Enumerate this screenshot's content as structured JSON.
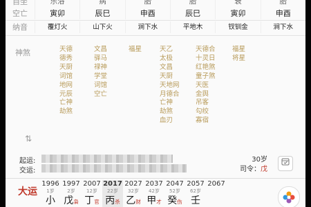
{
  "pillars_table": {
    "labels": [
      "自坐",
      "空亡",
      "纳音"
    ],
    "columns": [
      {
        "top": "乐浴",
        "kongwang": "寅卯",
        "nayin": "覆灯火"
      },
      {
        "top": "病",
        "kongwang": "辰巳",
        "nayin": "山下火"
      },
      {
        "top": "胎",
        "kongwang": "申酉",
        "nayin": "涧下水"
      },
      {
        "top": "胎",
        "kongwang": "辰巳",
        "nayin": "平地木"
      },
      {
        "top": "衰",
        "kongwang": "寅卯",
        "nayin": "钗钏金"
      },
      {
        "top": "胎",
        "kongwang": "申酉",
        "nayin": "涧下水"
      }
    ]
  },
  "shensha": {
    "label": "神煞",
    "columns": [
      [
        "天德",
        "德秀",
        "天厨",
        "词馆",
        "地网",
        "元辰",
        "亡神",
        "劫煞"
      ],
      [
        "文昌",
        "驿马",
        "禄神",
        "学堂",
        "词馆",
        "空亡"
      ],
      [
        "福星"
      ],
      [
        "天乙",
        "太极",
        "文昌",
        "天厨",
        "天地网",
        "月德合",
        "亡神",
        "劫煞",
        "血刃"
      ],
      [
        "天德合",
        "十灵日",
        "红艳煞",
        "童子煞",
        "天医",
        "金舆",
        "吊客",
        "勾绞",
        "寡宿"
      ],
      [
        "福星",
        "将星"
      ]
    ]
  },
  "swap_icon": "⇅",
  "run_info": {
    "qiyun_label": "起运:",
    "jiaoyun_label": "交运:",
    "age_text": "30岁",
    "siling_label": "司令：",
    "siling_value": "戊",
    "calendar_icon": "calendar-icon"
  },
  "dayun": {
    "label": "大运",
    "items": [
      {
        "year": "1996",
        "age": "1岁",
        "gan": "小",
        "ten_god": ""
      },
      {
        "year": "1997",
        "age": "2岁",
        "gan": "戊",
        "ten_god": "枭"
      },
      {
        "year": "2007",
        "age": "12岁",
        "gan": "丁",
        "ten_god": "官"
      },
      {
        "year": "2017",
        "age": "22岁",
        "gan": "丙",
        "ten_god": "杀"
      },
      {
        "year": "2027",
        "age": "32岁",
        "gan": "乙",
        "ten_god": "财"
      },
      {
        "year": "2037",
        "age": "42岁",
        "gan": "甲",
        "ten_god": "才"
      },
      {
        "year": "2047",
        "age": "52岁",
        "gan": "癸",
        "ten_god": "伤"
      },
      {
        "year": "2057",
        "age": "62岁",
        "gan": "壬",
        "ten_god": ""
      },
      {
        "year": "2067",
        "age": "",
        "gan": "",
        "ten_god": ""
      }
    ]
  },
  "fab_icon": "app-logo-icon"
}
